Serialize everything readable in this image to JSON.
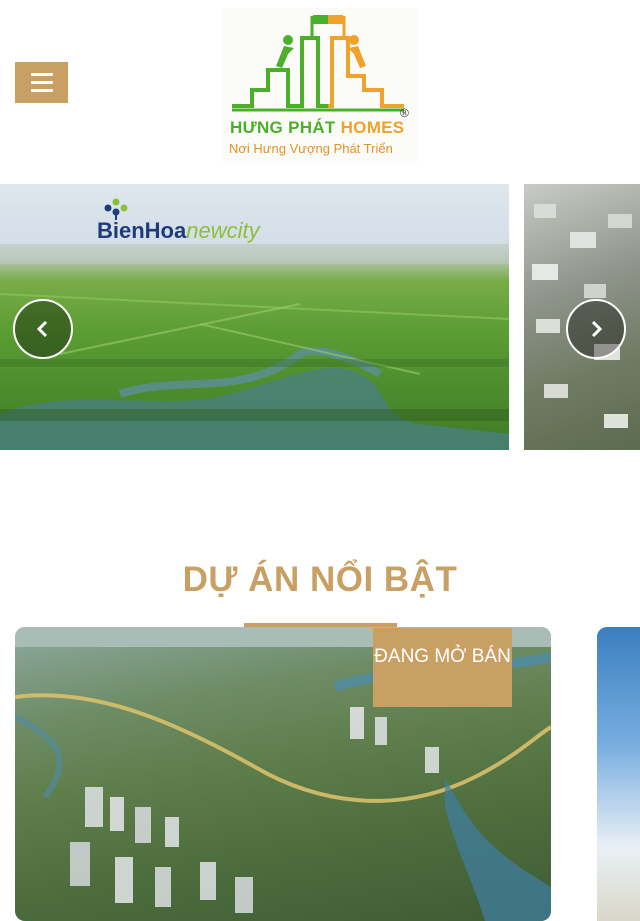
{
  "header": {
    "menu_icon": "hamburger-icon",
    "brand_part1": "HƯNG PHÁT ",
    "brand_part2": "HOMES",
    "registered": "®",
    "tagline": "Nơi Hưng Vượng Phát Triển",
    "brand_colors": {
      "green": "#4caf2a",
      "orange": "#f0a22a",
      "gold": "#c9a063"
    }
  },
  "slider": {
    "slide_logo_part1": "BienHoa",
    "slide_logo_part2": "newcity",
    "prev_icon": "chevron-left-icon",
    "next_icon": "chevron-right-icon"
  },
  "featured": {
    "title": "DỰ ÁN NỔI BẬT",
    "badge": "ĐANG MỞ BÁN"
  }
}
